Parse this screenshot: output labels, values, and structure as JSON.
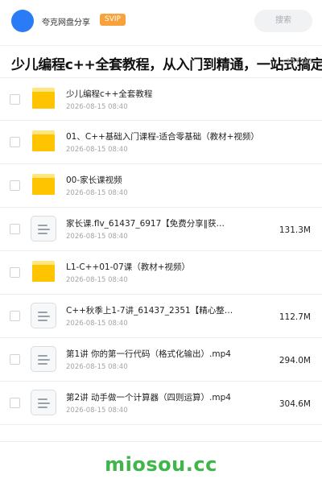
{
  "header": {
    "username": "夸克网盘分享",
    "badge": "SVIP",
    "search_placeholder": "搜索"
  },
  "share": {
    "title": "少儿编程c++全套教程，从入门到精通，一站式搞定。",
    "total_size": "157.0G"
  },
  "files": [
    {
      "type": "folder",
      "name": "少儿编程c++全套教程",
      "date": "2026-08-15 08:40",
      "size": ""
    },
    {
      "type": "folder",
      "name": "01、C++基础入门课程-适合零基础（教材+视频）",
      "date": "2026-08-15 08:40",
      "size": ""
    },
    {
      "type": "folder",
      "name": "00-家长课视频",
      "date": "2026-08-15 08:40",
      "size": ""
    },
    {
      "type": "file",
      "name": "家长课.flv_61437_6917【免费分享‖获…",
      "date": "2026-08-15 08:40",
      "size": "131.3M"
    },
    {
      "type": "folder",
      "name": "L1-C++01-07课（教材+视频）",
      "date": "2026-08-15 08:40",
      "size": ""
    },
    {
      "type": "file",
      "name": "C++秋季上1-7讲_61437_2351【精心整…",
      "date": "2026-08-15 08:40",
      "size": "112.7M"
    },
    {
      "type": "file",
      "name": "第1讲 你的第一行代码（格式化输出）.mp4",
      "date": "2026-08-15 08:40",
      "size": "294.0M"
    },
    {
      "type": "file",
      "name": "第2讲 动手做一个计算器（四则运算）.mp4",
      "date": "2026-08-15 08:40",
      "size": "304.6M"
    }
  ],
  "footer": {
    "watermark": "miosou.cc"
  },
  "colors": {
    "accent_blue": "#2a7cf6",
    "svip_orange": "#f7a23b",
    "folder_yellow": "#ffc400",
    "watermark_green": "#3fb649"
  }
}
